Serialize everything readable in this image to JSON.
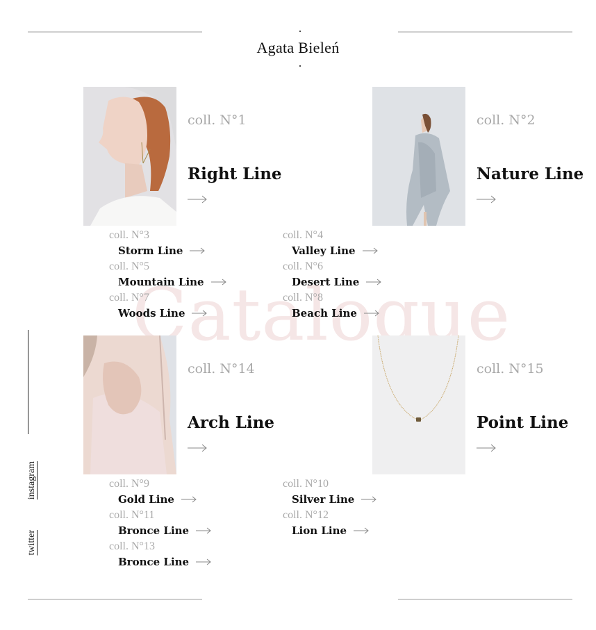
{
  "brand": "Agata Bieleń",
  "watermark": "Catalogue",
  "social": {
    "instagram": "instagram",
    "twitter": "twitter"
  },
  "featured": [
    {
      "coll": "coll. N°1",
      "title": "Right Line",
      "image": "woman-profile-earring-photo"
    },
    {
      "coll": "coll. N°2",
      "title": "Nature Line",
      "image": "woman-grey-poncho-photo"
    },
    {
      "coll": "coll. N°14",
      "title": "Arch Line",
      "image": "woman-neck-hand-photo"
    },
    {
      "coll": "coll. N°15",
      "title": "Point Line",
      "image": "gold-necklace-photo"
    }
  ],
  "lines_upper": [
    {
      "coll": "coll. N°3",
      "title": "Storm Line"
    },
    {
      "coll": "coll. N°4",
      "title": "Valley Line"
    },
    {
      "coll": "coll. N°5",
      "title": "Mountain Line"
    },
    {
      "coll": "coll. N°6",
      "title": "Desert Line"
    },
    {
      "coll": "coll. N°7",
      "title": "Woods Line"
    },
    {
      "coll": "coll. N°8",
      "title": "Beach Line"
    }
  ],
  "lines_lower": [
    {
      "coll": "coll. N°9",
      "title": "Gold Line"
    },
    {
      "coll": "coll. N°10",
      "title": "Silver Line"
    },
    {
      "coll": "coll. N°11",
      "title": "Bronce Line"
    },
    {
      "coll": "coll. N°12",
      "title": "Lion Line"
    },
    {
      "coll": "coll. N°13",
      "title": "Bronce Line"
    }
  ],
  "colors": {
    "muted": "#a9a9a9",
    "rule": "#cfcfcf",
    "watermark": "#f5e6e6",
    "text": "#111111"
  }
}
